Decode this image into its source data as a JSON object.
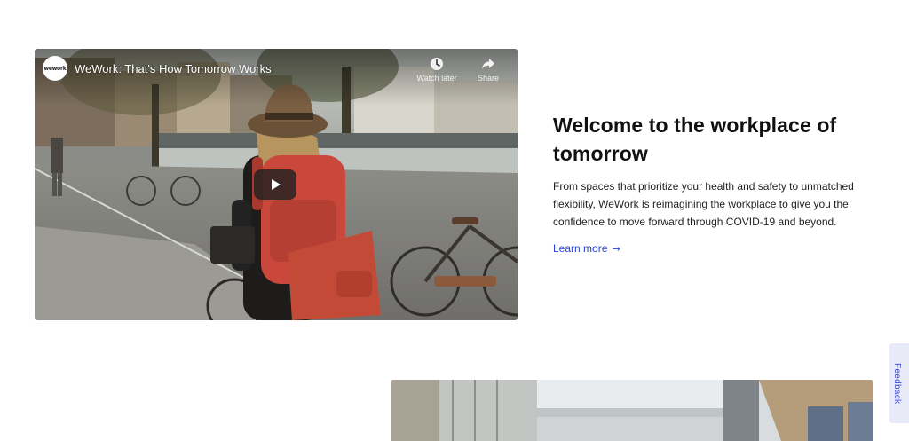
{
  "video": {
    "channel_logo_text": "wework",
    "title": "WeWork: That's How Tomorrow Works",
    "watch_later_label": "Watch later",
    "share_label": "Share",
    "icons": {
      "watch_later": "clock-icon",
      "share": "share-arrow-icon",
      "play": "play-icon"
    }
  },
  "content": {
    "heading": "Welcome to the workplace of tomorrow",
    "description": "From spaces that prioritize your health and safety to unmatched flexibility, WeWork is reimagining the workplace to give you the confidence to move forward through COVID-19 and beyond.",
    "learn_more_label": "Learn more",
    "learn_more_arrow": "→"
  },
  "feedback": {
    "label": "Feedback"
  },
  "colors": {
    "link": "#2744d6",
    "feedback_tab_bg": "#e9eaf7",
    "feedback_text": "#3a4bd8",
    "heading": "#111111",
    "body_text": "#222222",
    "play_button": "#212121"
  }
}
